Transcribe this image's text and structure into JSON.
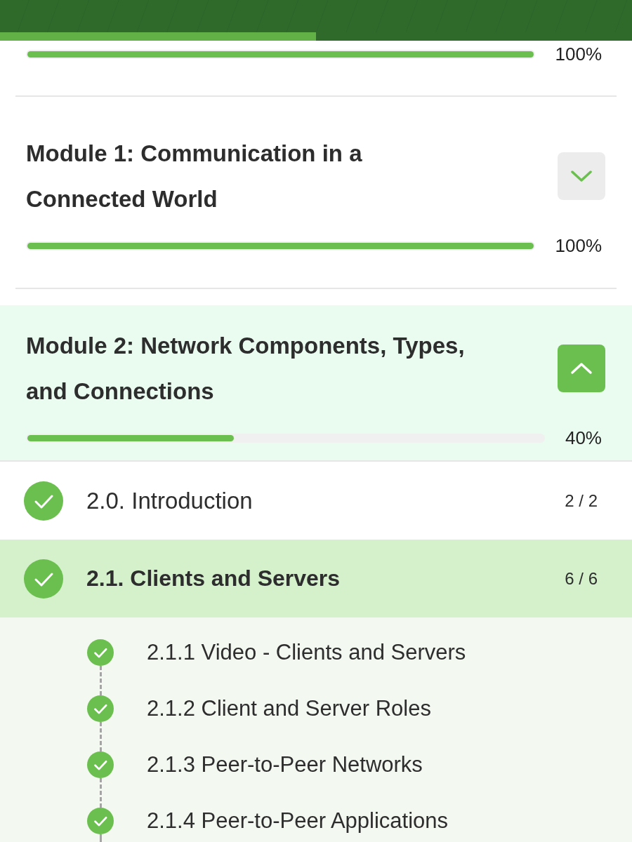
{
  "header": {
    "level": 0.5
  },
  "modules": [
    {
      "level": 1,
      "reading": "100%"
    },
    {
      "title": "Module 1: Communication in a Connected World",
      "expanded": false,
      "level": 1,
      "reading": "100%"
    },
    {
      "title": "Module 2: Network Components, Types, and Connections",
      "expanded": true,
      "level": 0.4,
      "reading": "40%",
      "sections": [
        {
          "label": "2.0. Introduction",
          "count": "2 / 2",
          "completed": true,
          "selected": false
        },
        {
          "label": "2.1. Clients and Servers",
          "count": "6 / 6",
          "completed": true,
          "selected": true,
          "topics": [
            {
              "label": "2.1.1 Video - Clients and Servers",
              "completed": true
            },
            {
              "label": "2.1.2 Client and Server Roles",
              "completed": true
            },
            {
              "label": "2.1.3 Peer-to-Peer Networks",
              "completed": true
            },
            {
              "label": "2.1.4 Peer-to-Peer Applications",
              "completed": true
            }
          ]
        }
      ]
    }
  ]
}
